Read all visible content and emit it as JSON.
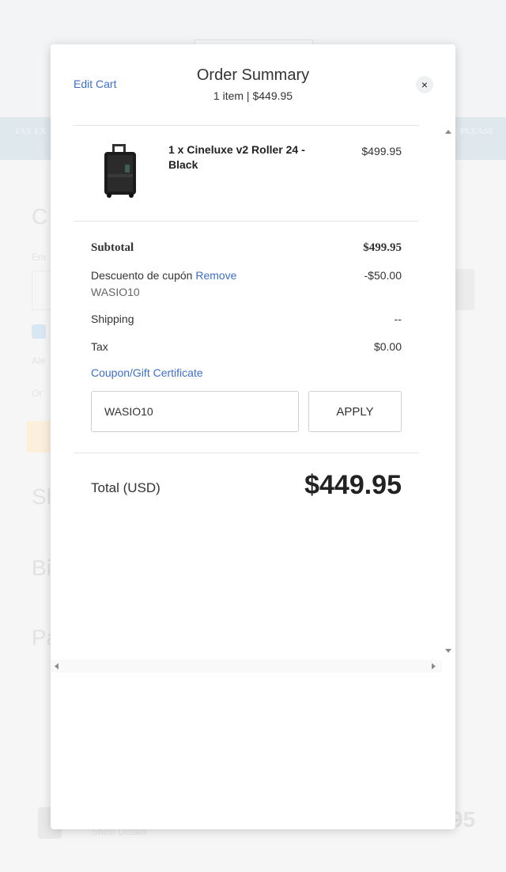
{
  "background": {
    "banner_left": "TAX EX",
    "banner_right": "PLEASE",
    "fragments": [
      "C",
      "Em",
      "Ale",
      "Or",
      "Sh",
      "Bi",
      "Pa"
    ],
    "bottom_text": "Show Details",
    "bottom_price": "95"
  },
  "modal": {
    "edit_cart_label": "Edit Cart",
    "title": "Order Summary",
    "subtitle": "1 item | $449.95",
    "close_label": "×"
  },
  "item": {
    "name": "1 x Cineluxe v2 Roller 24 - Black",
    "price": "$499.95",
    "image_icon": "rolling-case-icon"
  },
  "totals": {
    "subtotal_label": "Subtotal",
    "subtotal_value": "$499.95",
    "discount_label": "Descuento de cupón",
    "discount_remove": "Remove",
    "discount_value": "-$50.00",
    "coupon_code": "WASIO10",
    "shipping_label": "Shipping",
    "shipping_value": "--",
    "tax_label": "Tax",
    "tax_value": "$0.00"
  },
  "coupon": {
    "link_label": "Coupon/Gift Certificate",
    "input_value": "WASIO10",
    "apply_label": "APPLY"
  },
  "total": {
    "label": "Total (USD)",
    "value": "$449.95"
  },
  "colors": {
    "link": "#3d6fc9",
    "banner": "#dfe8ec"
  }
}
